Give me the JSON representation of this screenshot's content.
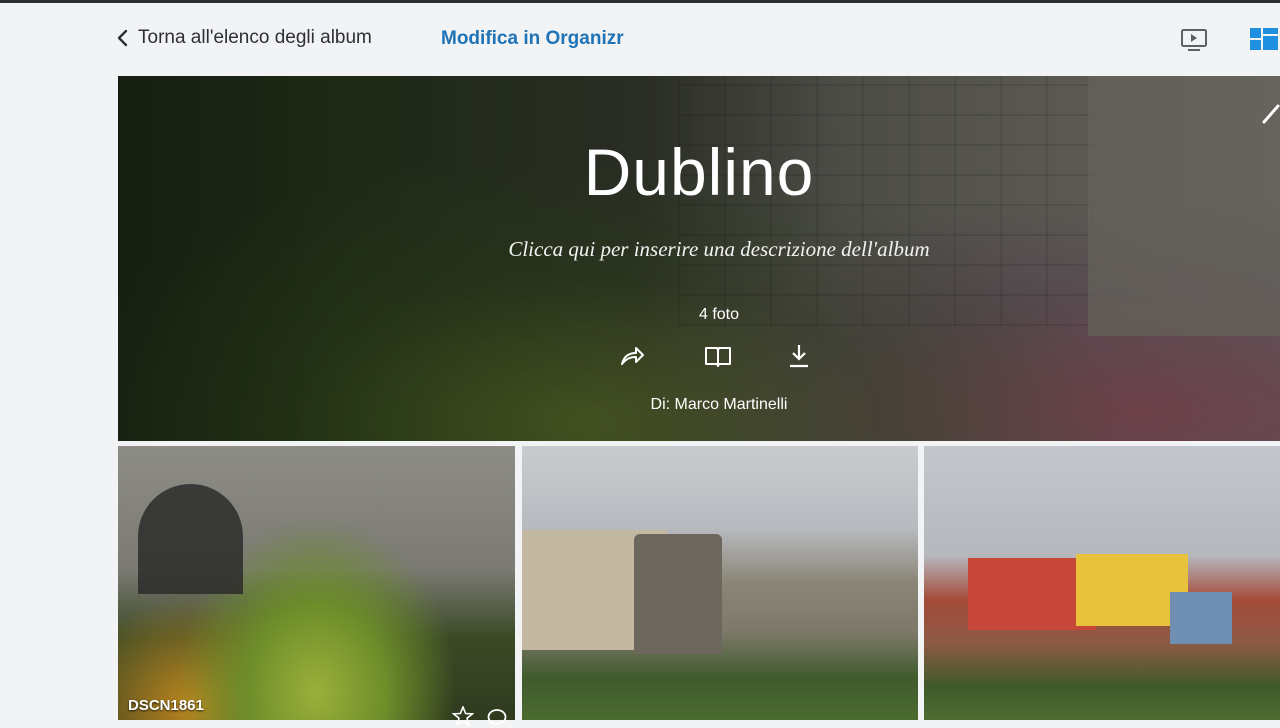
{
  "header": {
    "back_label": "Torna all'elenco degli album",
    "organizr_label": "Modifica in Organizr",
    "icons": [
      "chevron-left-icon",
      "slideshow-icon",
      "grid-layout-icon"
    ],
    "accent_color": "#1f73b7"
  },
  "album": {
    "title": "Dublino",
    "description_placeholder": "Clicca qui per inserire una descrizione dell'album",
    "photo_count": "4 foto",
    "author": "Di: Marco Martinelli",
    "actions": [
      "share-icon",
      "book-icon",
      "download-icon"
    ]
  },
  "photos": [
    {
      "name": "DSCN1861",
      "icons": [
        "star-icon",
        "comment-icon"
      ]
    }
  ]
}
